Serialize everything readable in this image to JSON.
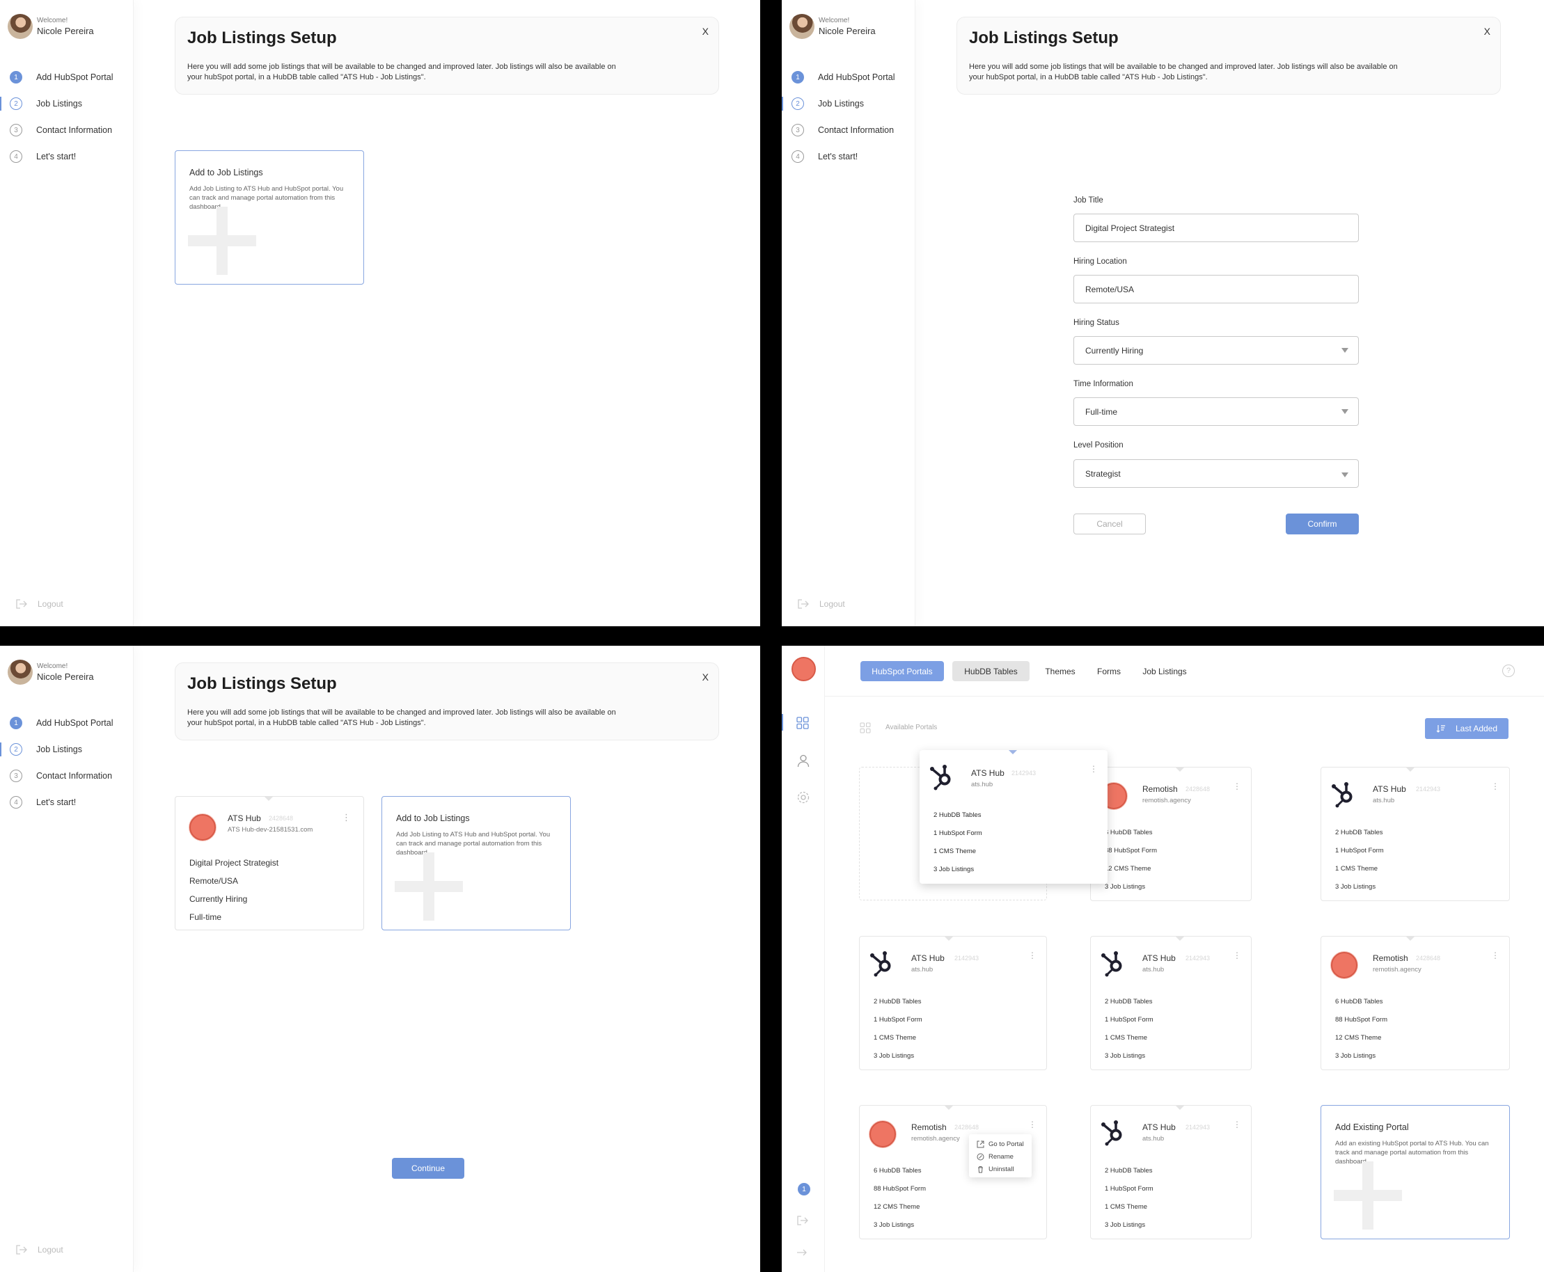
{
  "user": {
    "welcome": "Welcome!",
    "name": "Nicole Pereira"
  },
  "steps": [
    "Add HubSpot Portal",
    "Job Listings",
    "Contact Information",
    "Let's start!"
  ],
  "logout": "Logout",
  "setup": {
    "title": "Job Listings Setup",
    "description": "Here you will add some job listings that will be available to be changed and improved later. Job listings will also be available on your hubSpot portal, in a HubDB table called \"ATS Hub - Job Listings\".",
    "close": "X"
  },
  "add_listing": {
    "title": "Add to Job Listings",
    "title_alt": "Add to Job Listings",
    "description": "Add Job Listing to ATS Hub and HubSpot portal. You can track and manage portal automation from this dashboard."
  },
  "form": {
    "job_title_label": "Job Title",
    "job_title_value": "Digital Project Strategist",
    "location_label": "Hiring Location",
    "location_value": "Remote/USA",
    "status_label": "Hiring Status",
    "status_value": "Currently Hiring",
    "time_label": "Time Information",
    "time_value": "Full-time",
    "level_label": "Level Position",
    "level_value": "Strategist",
    "cancel": "Cancel",
    "confirm": "Confirm"
  },
  "listing_card": {
    "name": "ATS Hub",
    "id": "2428648",
    "domain": "ATS Hub-dev-21581531.com",
    "lines": [
      "Digital Project Strategist",
      "Remote/USA",
      "Currently Hiring",
      "Full-time"
    ]
  },
  "continue": "Continue",
  "dashboard": {
    "tabs": [
      "HubSpot Portals",
      "HubDB Tables",
      "Themes",
      "Forms",
      "Job Listings"
    ],
    "help": "?",
    "available": "Available Portals",
    "sort": "Last Added",
    "badge": "1",
    "popup": {
      "name": "ATS Hub",
      "id": "2142943",
      "domain": "ats.hub",
      "stats": [
        "2 HubDB Tables",
        "1 HubSpot Form",
        "1 CMS Theme",
        "3 Job Listings"
      ]
    },
    "portals": [
      {
        "type": "remotish",
        "name": "Remotish",
        "id": "2428648",
        "domain": "remotish.agency",
        "stats": [
          "6 HubDB Tables",
          "88 HubSpot Form",
          "12 CMS Theme",
          "3 Job Listings"
        ]
      },
      {
        "type": "hubspot",
        "name": "ATS Hub",
        "id": "2142943",
        "domain": "ats.hub",
        "stats": [
          "2 HubDB Tables",
          "1 HubSpot Form",
          "1 CMS Theme",
          "3 Job Listings"
        ]
      },
      {
        "type": "hubspot",
        "name": "ATS Hub",
        "id": "2142943",
        "domain": "ats.hub",
        "stats": [
          "2 HubDB Tables",
          "1 HubSpot Form",
          "1 CMS Theme",
          "3 Job Listings"
        ]
      },
      {
        "type": "hubspot",
        "name": "ATS Hub",
        "id": "2142943",
        "domain": "ats.hub",
        "stats": [
          "2 HubDB Tables",
          "1 HubSpot Form",
          "1 CMS Theme",
          "3 Job Listings"
        ]
      },
      {
        "type": "remotish",
        "name": "Remotish",
        "id": "2428648",
        "domain": "remotish.agency",
        "stats": [
          "6 HubDB Tables",
          "88 HubSpot Form",
          "12 CMS Theme",
          "3 Job Listings"
        ]
      },
      {
        "type": "remotish",
        "name": "Remotish",
        "id": "2428648",
        "domain": "remotish.agency",
        "stats": [
          "6 HubDB Tables",
          "88 HubSpot Form",
          "12 CMS Theme",
          "3 Job Listings"
        ]
      },
      {
        "type": "hubspot",
        "name": "ATS Hub",
        "id": "2142943",
        "domain": "ats.hub",
        "stats": [
          "2 HubDB Tables",
          "1 HubSpot Form",
          "1 CMS Theme",
          "3 Job Listings"
        ]
      }
    ],
    "context_menu": [
      "Go to Portal",
      "Rename",
      "Uninstall"
    ],
    "add_existing": {
      "title": "Add Existing Portal",
      "description": "Add an existing HubSpot portal to ATS Hub. You can track and manage portal automation from this dashboard."
    }
  }
}
